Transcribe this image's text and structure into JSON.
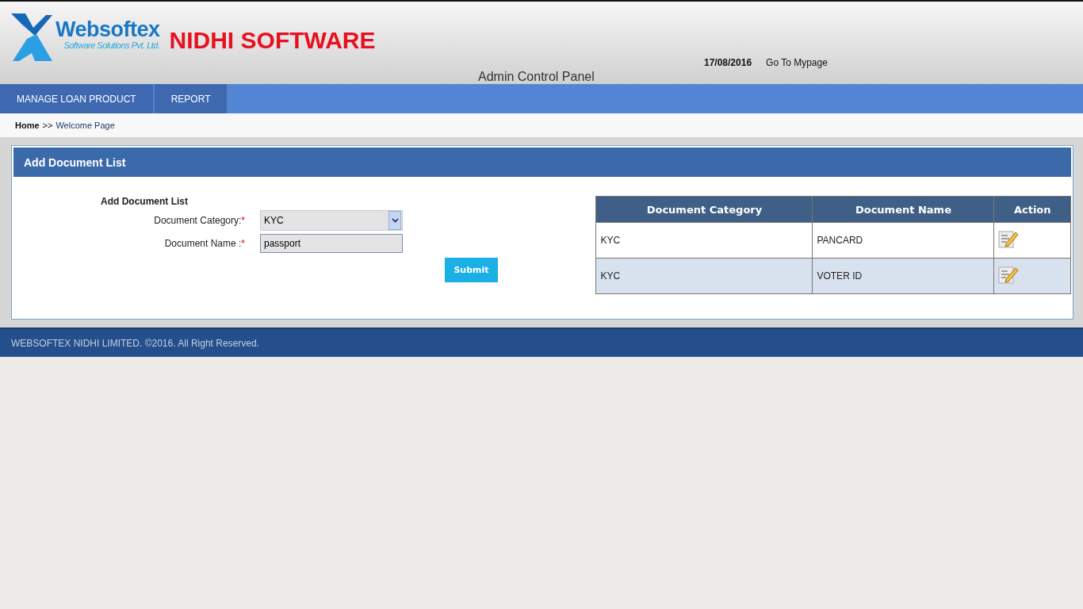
{
  "header": {
    "logo_name": "Websoftex",
    "logo_tagline": "Software Solutions Pvt. Ltd.",
    "product": "NIDHI SOFTWARE",
    "date": "17/08/2016",
    "mypage_link": "Go To Mypage",
    "panel_title": "Admin Control Panel"
  },
  "nav": [
    {
      "label": "MANAGE LOAN PRODUCT"
    },
    {
      "label": "REPORT"
    }
  ],
  "breadcrumb": {
    "home": "Home",
    "separator": ">>",
    "current": "Welcome Page"
  },
  "panel": {
    "title": "Add Document List",
    "form": {
      "heading": "Add Document List",
      "fields": [
        {
          "kind": "select",
          "label": "Document Category:",
          "required": "*",
          "value": "KYC"
        },
        {
          "kind": "text",
          "label": "Document Name :",
          "required": "*",
          "value": "passport"
        }
      ],
      "submit": "Submit"
    },
    "table": {
      "columns": [
        "Document Category",
        "Document Name",
        "Action"
      ],
      "rows": [
        {
          "category": "KYC",
          "name": "PANCARD"
        },
        {
          "category": "KYC",
          "name": "VOTER ID"
        }
      ]
    }
  },
  "footer": "WEBSOFTEX NIDHI LIMITED. ©2016. All Right Reserved."
}
